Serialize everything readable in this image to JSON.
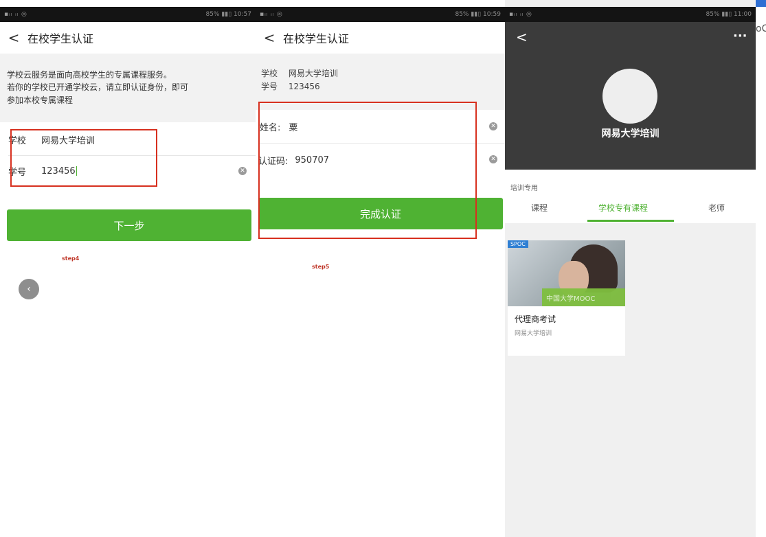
{
  "screen1": {
    "status": {
      "signal": "▪ᵢₗ ᵢₗ ◎",
      "battery_time": "85% ▮▮▯ 10:57"
    },
    "nav": {
      "back": "<",
      "title": "在校学生认证"
    },
    "intro_line1": "学校云服务是面向高校学生的专属课程服务。",
    "intro_line2": "若你的学校已开通学校云，请立即认证身份，即可",
    "intro_line3": "参加本校专属课程",
    "school_label": "学校",
    "school_value": "网易大学培训",
    "id_label": "学号",
    "id_value": "123456",
    "next_button": "下一步",
    "step_label": "step4"
  },
  "screen2": {
    "status": {
      "signal": "▪ᵢₗ ᵢₗ ◎",
      "battery_time": "85% ▮▮▯ 10:59"
    },
    "nav": {
      "back": "<",
      "title": "在校学生认证"
    },
    "school_label": "学校",
    "school_value": "网易大学培训",
    "id_label": "学号",
    "id_value": "123456",
    "name_label": "姓名:",
    "name_value": "粟",
    "code_label": "认证码:",
    "code_value": "950707",
    "complete_button": "完成认证",
    "step_label": "step5"
  },
  "screen3": {
    "status": {
      "signal": "▪ᵢₗ ᵢₗ ◎",
      "battery_time": "85% ▮▮▯ 11:00"
    },
    "nav": {
      "back": "<",
      "more": "···"
    },
    "school_name": "网易大学培训",
    "section_label": "培训专用",
    "tabs": [
      {
        "label": "课程",
        "active": false
      },
      {
        "label": "学校专有课程",
        "active": true
      },
      {
        "label": "老师",
        "active": false
      }
    ],
    "course": {
      "badge": "SPOC",
      "banner": "中国大学MOOC",
      "title": "代理商考试",
      "school": "网易大学培训"
    },
    "edge_text": "oC"
  },
  "colors": {
    "accent": "#4fb233",
    "highlight": "#d7301f",
    "header_dark": "#3b3b3b"
  }
}
